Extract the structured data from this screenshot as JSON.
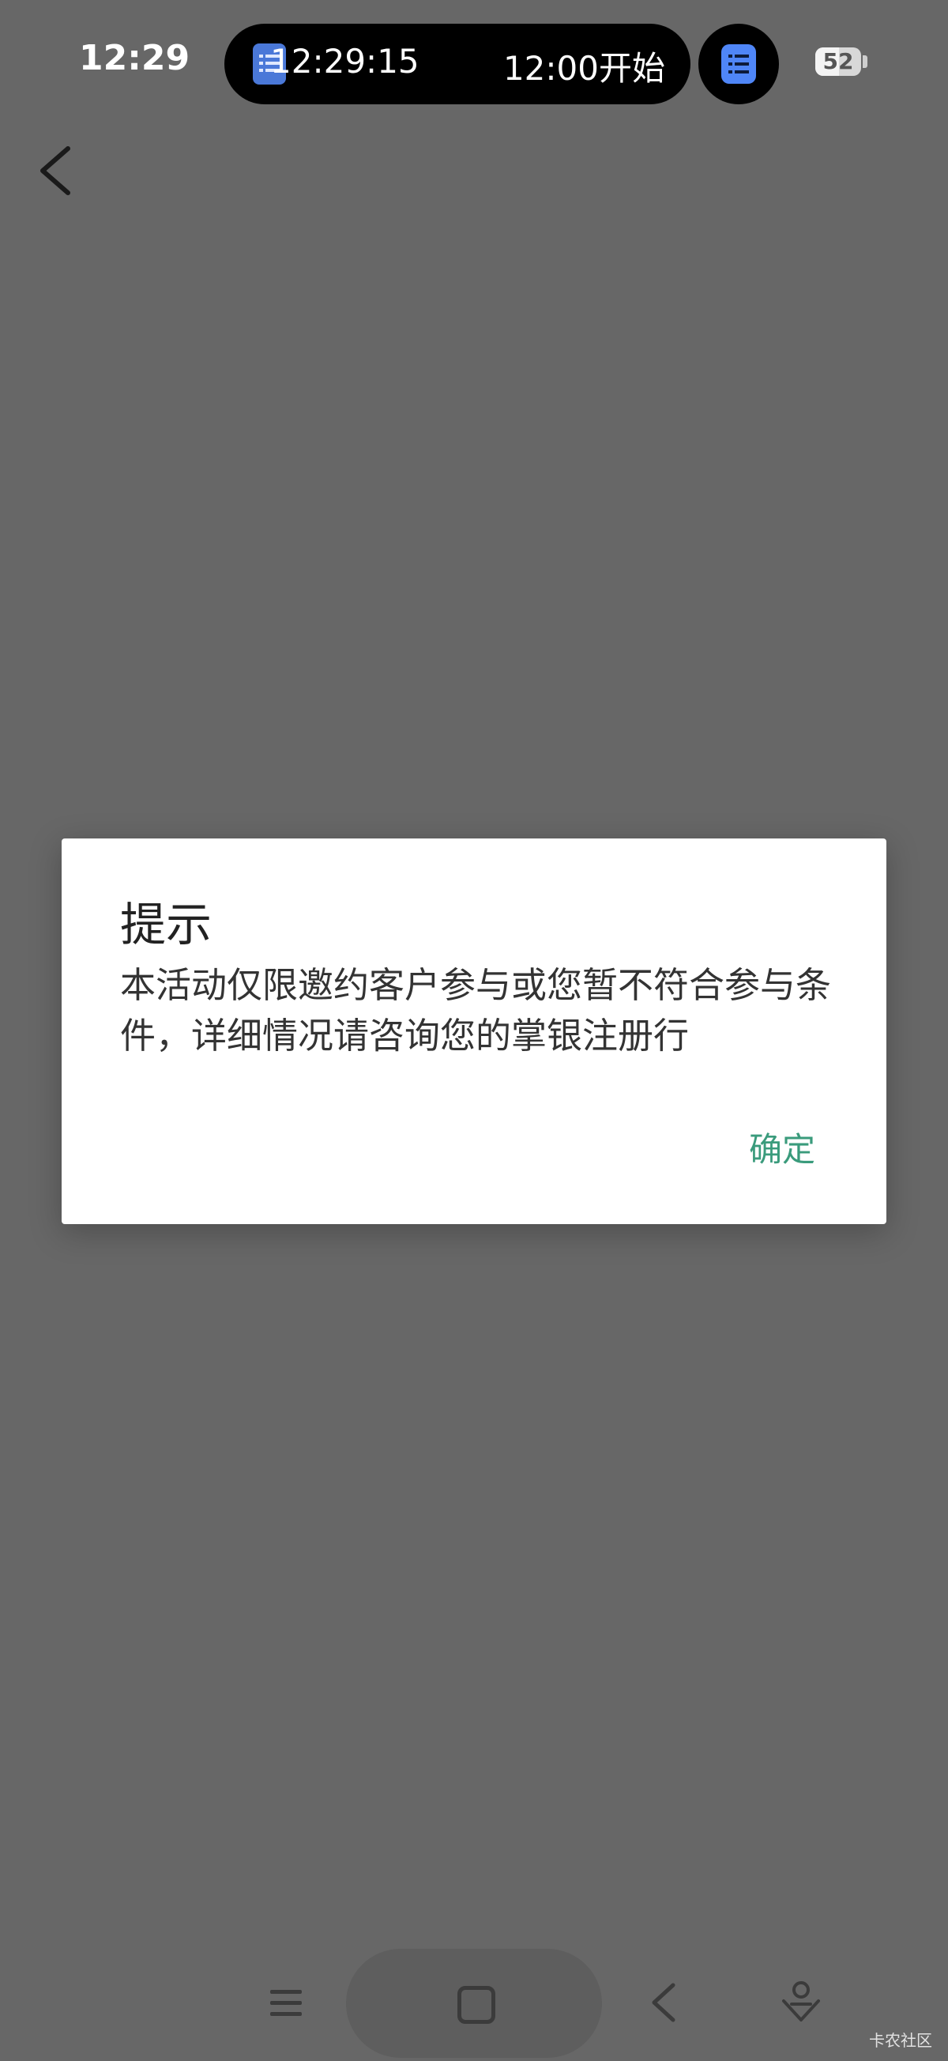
{
  "status_bar": {
    "time": "12:29",
    "island_clock": "12:29:15",
    "island_start_text": "12:00开始",
    "battery_level": "52",
    "battery_fraction": 0.52
  },
  "nav": {
    "back_icon": "chevron-left-icon"
  },
  "dialog": {
    "title": "提示",
    "message": "本活动仅限邀约客户参与或您暂不符合参与条件，详细情况请咨询您的掌银注册行",
    "confirm_label": "确定"
  },
  "bottom_nav": {
    "icons": [
      "menu-icon",
      "home-icon",
      "back-icon",
      "assistant-icon"
    ]
  },
  "watermark": "卡农社区",
  "colors": {
    "background_overlay": "#676767",
    "dialog_bg": "#ffffff",
    "confirm_accent": "#3a9b7c",
    "island_icon": "#4f86f7"
  }
}
